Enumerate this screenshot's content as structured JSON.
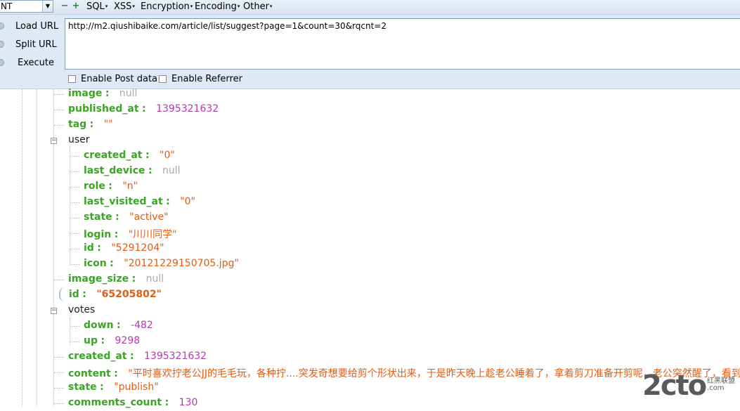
{
  "hackbar": {
    "combo_value": "NT",
    "menus": [
      "SQL",
      "XSS",
      "Encryption",
      "Encoding",
      "Other"
    ],
    "buttons": {
      "load_url": "Load URL",
      "split_url": "Split URL",
      "execute": "Execute"
    },
    "url": "http://m2.qiushibaike.com/article/list/suggest?page=1&count=30&rqcnt=2",
    "enable_post": "Enable Post data",
    "enable_referrer": "Enable Referrer"
  },
  "tree": {
    "colon": ":",
    "image": {
      "key": "image",
      "value": "null"
    },
    "published_at": {
      "key": "published_at",
      "value": "1395321632"
    },
    "tag": {
      "key": "tag",
      "value": "\"\""
    },
    "user": {
      "label": "user",
      "created_at": {
        "key": "created_at",
        "value": "\"0\""
      },
      "last_device": {
        "key": "last_device",
        "value": "null"
      },
      "role": {
        "key": "role",
        "value": "\"n\""
      },
      "last_visited_at": {
        "key": "last_visited_at",
        "value": "\"0\""
      },
      "state": {
        "key": "state",
        "value": "\"active\""
      },
      "login": {
        "key": "login",
        "value": "\"川川同学\""
      },
      "id": {
        "key": "id",
        "value": "\"5291204\""
      },
      "icon": {
        "key": "icon",
        "value": "\"20121229150705.jpg\""
      }
    },
    "image_size": {
      "key": "image_size",
      "value": "null"
    },
    "id": {
      "key": "id",
      "value": "\"65205802\""
    },
    "votes": {
      "label": "votes",
      "down": {
        "key": "down",
        "value": "-482"
      },
      "up": {
        "key": "up",
        "value": "9298"
      }
    },
    "created_at": {
      "key": "created_at",
      "value": "1395321632"
    },
    "content": {
      "key": "content",
      "value": "\"平时喜欢拧老公JJ的毛毛玩，各种拧....突发奇想要给剪个形状出来，于是昨天晚上趁老公睡着了，拿着剪刀准备开剪呢，老公突然醒了，看到"
    },
    "state": {
      "key": "state",
      "value": "\"publish\""
    },
    "comments_count": {
      "key": "comments_count",
      "value": "130"
    }
  },
  "watermark": {
    "big": "2cto",
    "small1": "红黑联盟",
    "small2": ".com"
  }
}
